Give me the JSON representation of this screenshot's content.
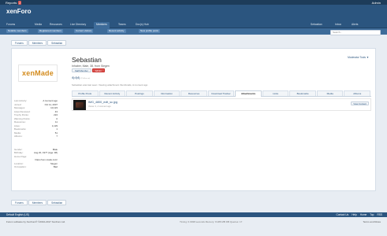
{
  "topbar": {
    "reports_label": "Reports:",
    "reports_count": "2",
    "admin_label": "Admin"
  },
  "header": {
    "logo_text": "xenForo"
  },
  "nav": {
    "tabs": [
      "Forums",
      "Media",
      "Resources",
      "Live Directory",
      "Members",
      "Teams",
      "Doc(s) Hub"
    ],
    "active_index": 4,
    "right": [
      "Sebastian",
      "Inbox",
      "Alerts"
    ]
  },
  "subnav": {
    "items": [
      "Notable members",
      "Registered members",
      "Current visitors",
      "Recent activity",
      "New profile posts"
    ]
  },
  "search": {
    "placeholder": "Search..."
  },
  "breadcrumbs": [
    "Forums",
    "Members",
    "Sebastian"
  ],
  "profile": {
    "avatar_text": "xenMade",
    "name": "Sebastian",
    "subtitle": "Inhaber, Male, 38, from Siegen",
    "buttons": [
      {
        "label": "Staff Member",
        "style": "normal"
      },
      {
        "label": "Admin",
        "style": "red"
      }
    ],
    "mood": "djdjdj",
    "mood_note": "(Follow us)",
    "last_seen": "Sebastian was last seen: Viewing attachment thumbnails, A moment ago",
    "moderator_tools": "Moderator Tools ▼"
  },
  "stats": [
    {
      "k": "Last Activity:",
      "v": "A moment ago"
    },
    {
      "k": "Joined:",
      "v": "Oct 11, 2007"
    },
    {
      "k": "Messages:",
      "v": "10,123"
    },
    {
      "k": "Likes Received:",
      "v": "43"
    },
    {
      "k": "Trophy Points:",
      "v": "224"
    },
    {
      "k": "Warning Points:",
      "v": "0"
    },
    {
      "k": "Resources:",
      "v": "11"
    },
    {
      "k": "Likes:",
      "v": "1,129"
    },
    {
      "k": "Bookmarks:",
      "v": "1"
    },
    {
      "k": "Media:",
      "v": "51"
    },
    {
      "k": "Albums:",
      "v": "7"
    }
  ],
  "info": [
    {
      "k": "Gender:",
      "v": "Male"
    },
    {
      "k": "Birthday:",
      "v": "Aug 20, 1977 (Age: 38)"
    },
    {
      "k": "Home Page:",
      "v": ""
    },
    {
      "k": "",
      "v": "https://xen-made.com/"
    },
    {
      "k": "Location:",
      "v": "Siegen"
    },
    {
      "k": "Occupation:",
      "v": "Bad"
    }
  ],
  "tabs": [
    "Profile Posts",
    "Recent Activity",
    "Postings",
    "Information",
    "Resources",
    "Download Tracker",
    "Attachments",
    "Links",
    "Bookmarks",
    "Media",
    "Albums"
  ],
  "active_tab": "Attachments",
  "attachment": {
    "filename": "IMG_4800_edit_sc.jpg",
    "meta": "Views: 0, A moment ago",
    "view_button": "View Content"
  },
  "footer": {
    "left": "Default   English (US)",
    "links": [
      "Contact Us",
      "Help",
      "Home",
      "Top",
      "RSS"
    ],
    "copyright": "Forum software by XenForo® ©2010-2017 XenForo Ltd.",
    "timing": "Timing: 0.0938 seconds Memory: 8.286 MB DB Queries: 17",
    "terms": "Terms and Rules"
  }
}
